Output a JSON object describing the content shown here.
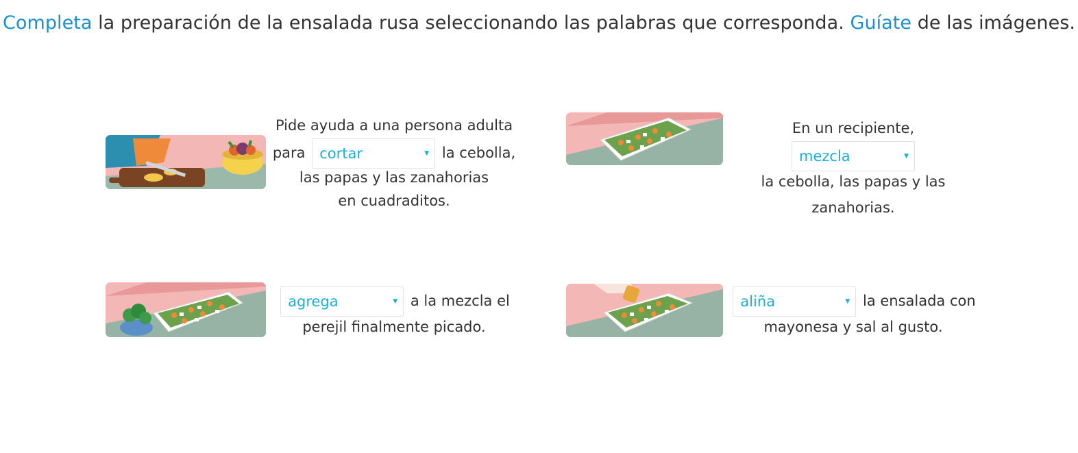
{
  "instruction": {
    "part1": "Completa",
    "part2": " la preparación de la ensalada rusa seleccionando las palabras que corresponda. ",
    "part3": "Guíate",
    "part4": " de las imágenes."
  },
  "steps": [
    {
      "image": "chopping-vegetables-illustration",
      "text_before_line1": "Pide ayuda a una persona adulta",
      "text_before_line2": "para",
      "selected": "cortar",
      "text_after": "la cebolla,",
      "text_tail": "las papas y las zanahorias en cuadraditos."
    },
    {
      "image": "salad-tray-illustration",
      "text_before": "En un recipiente,",
      "selected": "mezcla",
      "text_tail": "la cebolla, las papas y las zanahorias."
    },
    {
      "image": "parsley-bowl-and-salad-tray-illustration",
      "selected": "agrega",
      "text_after": "a la mezcla el",
      "text_tail": "perejil finalmente picado."
    },
    {
      "image": "seasoning-salad-illustration",
      "selected": "aliña",
      "text_after": "la ensalada con",
      "text_tail": "mayonesa y sal al gusto."
    }
  ],
  "icons": {
    "dropdown": "caret-down-icon"
  },
  "colors": {
    "highlight": "#1a8fd1",
    "dropdown_text": "#19b0d8",
    "body_text": "#333333"
  }
}
